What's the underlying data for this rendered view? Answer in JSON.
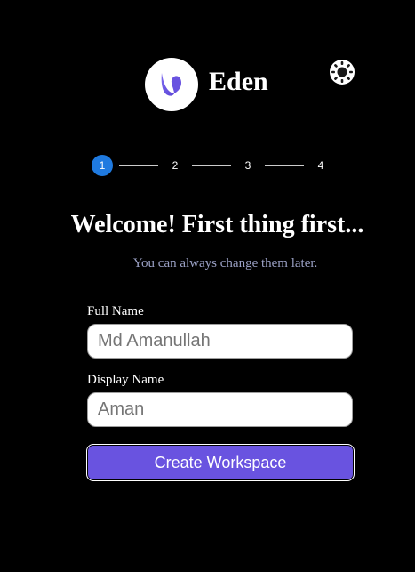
{
  "brand": {
    "name": "Eden",
    "logo_icon": "eden-leaf-logo",
    "logo_color": "#6953e0"
  },
  "header": {
    "theme_toggle_icon": "sun-icon"
  },
  "stepper": {
    "current_step": 1,
    "steps": [
      "1",
      "2",
      "3",
      "4"
    ],
    "active_color": "#1f7ae0"
  },
  "main": {
    "title": "Welcome! First thing first...",
    "subtitle": "You can always change them later."
  },
  "form": {
    "full_name": {
      "label": "Full Name",
      "placeholder": "Md Amanullah",
      "value": ""
    },
    "display_name": {
      "label": "Display Name",
      "placeholder": "Aman",
      "value": ""
    },
    "submit_label": "Create Workspace",
    "submit_color": "#6953e0"
  }
}
